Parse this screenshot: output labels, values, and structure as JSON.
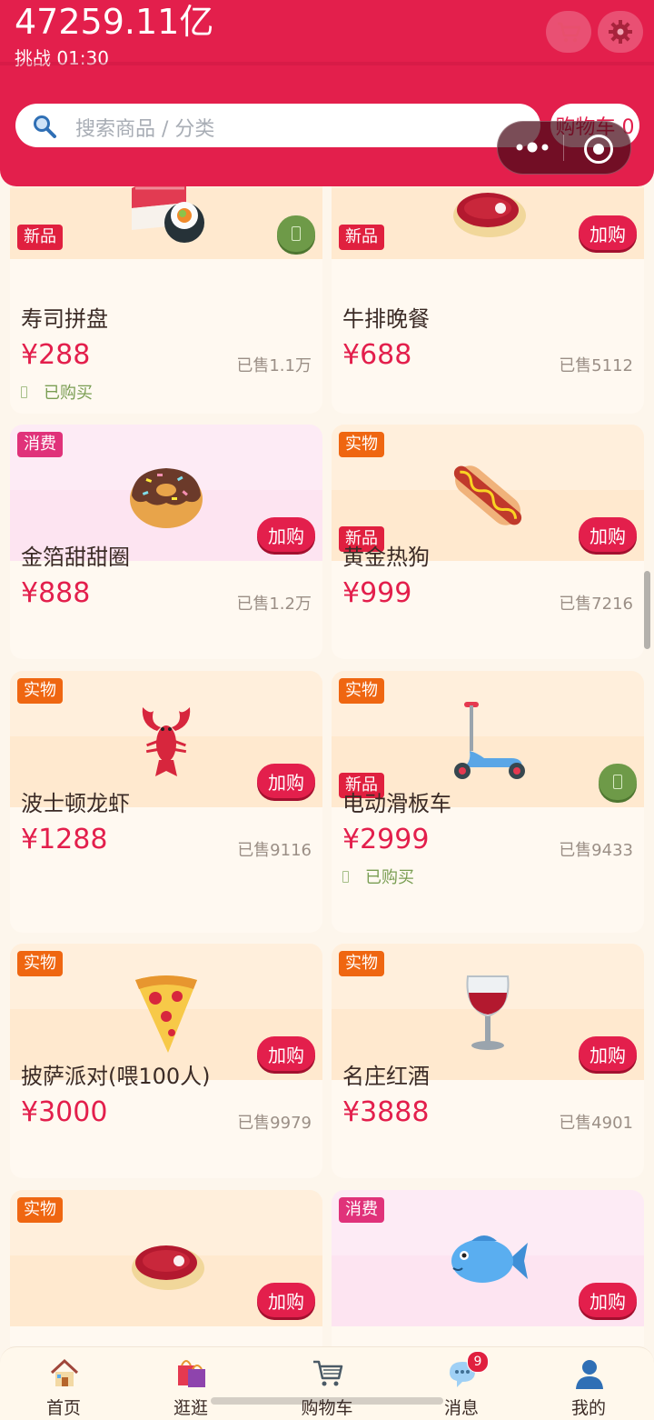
{
  "header": {
    "balance": "47259.11亿",
    "challenge": "挑战 01:30",
    "search_placeholder": "搜索商品 / 分类",
    "cart_label": "购物车 0",
    "icons": [
      "cart-icon",
      "gear-icon",
      "search-icon",
      "more-dots-icon",
      "record-icon"
    ]
  },
  "colors": {
    "accent": "#e31f4c",
    "background": "#fdf6ec",
    "card_cream": "#ffe9cf",
    "card_pink": "#fde4f1",
    "bought_green": "#6e9a48"
  },
  "add_label": "加购",
  "bought_label": "已购买",
  "products": [
    {
      "name": "寿司拼盘",
      "price": "¥288",
      "sold": "已售1.1万",
      "tags": [
        "新品"
      ],
      "icon": "sushi-icon",
      "bought": true
    },
    {
      "name": "牛排晚餐",
      "price": "¥688",
      "sold": "已售5112",
      "tags": [
        "新品"
      ],
      "icon": "steak-icon",
      "bought": false
    },
    {
      "name": "金箔甜甜圈",
      "price": "¥888",
      "sold": "已售1.2万",
      "tags": [
        "消费"
      ],
      "icon": "donut-icon",
      "bought": false
    },
    {
      "name": "黄金热狗",
      "price": "¥999",
      "sold": "已售7216",
      "tags": [
        "实物",
        "新品"
      ],
      "icon": "hotdog-icon",
      "bought": false
    },
    {
      "name": "波士顿龙虾",
      "price": "¥1288",
      "sold": "已售9116",
      "tags": [
        "实物"
      ],
      "icon": "lobster-icon",
      "bought": false
    },
    {
      "name": "电动滑板车",
      "price": "¥2999",
      "sold": "已售9433",
      "tags": [
        "实物",
        "新品"
      ],
      "icon": "scooter-icon",
      "bought": true
    },
    {
      "name": "披萨派对(喂100人)",
      "price": "¥3000",
      "sold": "已售9979",
      "tags": [
        "实物"
      ],
      "icon": "pizza-icon",
      "bought": false
    },
    {
      "name": "名庄红酒",
      "price": "¥3888",
      "sold": "已售4901",
      "tags": [
        "实物"
      ],
      "icon": "wine-glass-icon",
      "bought": false
    },
    {
      "tags": [
        "实物"
      ],
      "icon": "steak-icon",
      "bought": false
    },
    {
      "tags": [
        "消费"
      ],
      "icon": "fish-icon",
      "bought": false
    }
  ],
  "tabbar": [
    {
      "label": "首页",
      "icon": "house-icon"
    },
    {
      "label": "逛逛",
      "icon": "shopping-bags-icon"
    },
    {
      "label": "购物车",
      "icon": "cart-icon"
    },
    {
      "label": "消息",
      "icon": "chat-bubble-icon",
      "badge": "9"
    },
    {
      "label": "我的",
      "icon": "user-icon"
    }
  ]
}
